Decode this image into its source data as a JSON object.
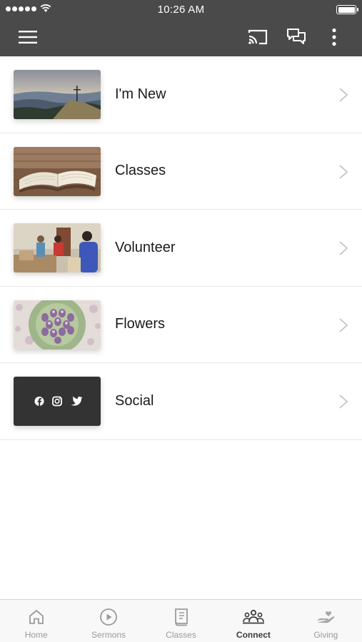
{
  "status_bar": {
    "time": "10:26 AM"
  },
  "app_bar": {
    "menu_icon": "hamburger-menu-icon",
    "cast_icon": "cast-icon",
    "chat_icon": "chat-icon",
    "more_icon": "more-vertical-icon"
  },
  "list": {
    "items": [
      {
        "label": "I'm New",
        "thumbnail": "mountain-cross-photo"
      },
      {
        "label": "Classes",
        "thumbnail": "open-bible-photo"
      },
      {
        "label": "Volunteer",
        "thumbnail": "volunteers-photo"
      },
      {
        "label": "Flowers",
        "thumbnail": "flower-bouquet-photo"
      },
      {
        "label": "Social",
        "thumbnail": "social-icons-tile"
      }
    ]
  },
  "tabbar": {
    "tabs": [
      {
        "label": "Home",
        "icon": "home-icon",
        "active": false
      },
      {
        "label": "Sermons",
        "icon": "play-circle-icon",
        "active": false
      },
      {
        "label": "Classes",
        "icon": "book-icon",
        "active": false
      },
      {
        "label": "Connect",
        "icon": "people-icon",
        "active": true
      },
      {
        "label": "Giving",
        "icon": "giving-hand-icon",
        "active": false
      }
    ]
  },
  "colors": {
    "header_bg": "#4a4a4a",
    "tab_active": "#3a3a3a",
    "tab_inactive": "#9a9a9a"
  }
}
